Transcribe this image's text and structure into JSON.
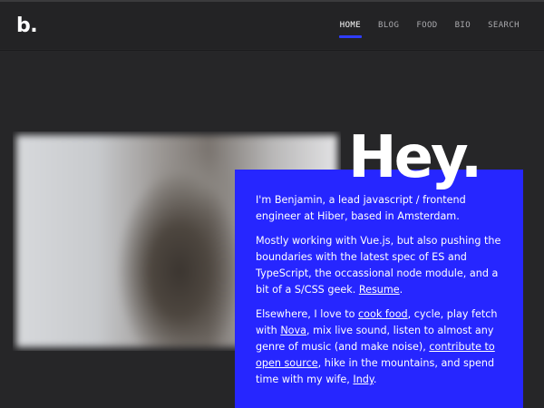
{
  "header": {
    "logo": "b.",
    "nav": [
      {
        "label": "HOME",
        "active": true
      },
      {
        "label": "BLOG",
        "active": false
      },
      {
        "label": "FOOD",
        "active": false
      },
      {
        "label": "BIO",
        "active": false
      },
      {
        "label": "SEARCH",
        "active": false
      }
    ]
  },
  "hero": {
    "heading": "Hey.",
    "intro": "I'm Benjamin, a lead javascript / frontend engineer at Hiber, based in Amsterdam.",
    "p2_text": "Mostly working with Vue.js, but also pushing the boundaries with the latest spec of ES and TypeScript, the occassional node module, and a bit of a S/CSS geek.",
    "resume_link": "Resume",
    "p3_a": "Elsewhere, I love to",
    "cook_link": "cook food",
    "p3_b": ", cycle, play fetch with",
    "nova_link": "Nova",
    "p3_c": ", mix live sound, listen to almost any genre of music (and make noise),",
    "oss_link": "contribute to open source",
    "p3_d": ", hike in the mountains, and spend time with my wife,",
    "indy_link": "Indy",
    "p3_e": "."
  },
  "colors": {
    "accent": "#2626ff",
    "background": "#262628"
  }
}
